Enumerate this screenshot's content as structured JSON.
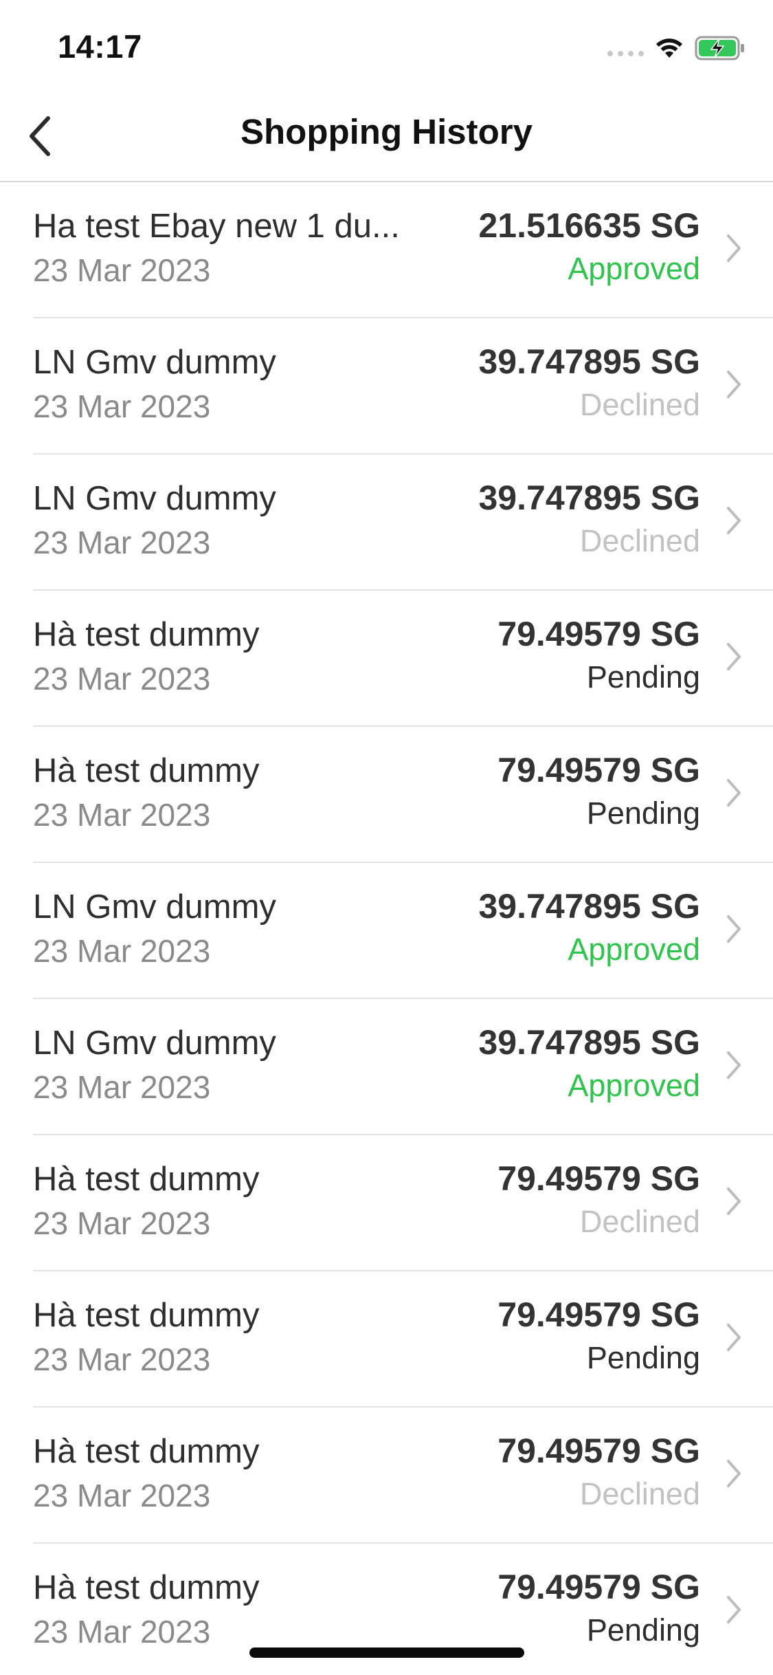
{
  "status_bar": {
    "time": "14:17",
    "icons": [
      "signal-dots-icon",
      "wifi-icon",
      "battery-charging-icon"
    ],
    "battery_color": "#34c759"
  },
  "nav": {
    "title": "Shopping History",
    "back_icon": "chevron-left-icon"
  },
  "colors": {
    "approved": "#2fc44c",
    "declined": "#c2c2c2",
    "pending": "#2e2e2e"
  },
  "transactions": [
    {
      "name": "Ha test Ebay new 1 du...",
      "date": "23 Mar 2023",
      "amount": "21.516635 SG",
      "status": "Approved"
    },
    {
      "name": "LN Gmv dummy",
      "date": "23 Mar 2023",
      "amount": "39.747895 SG",
      "status": "Declined"
    },
    {
      "name": "LN Gmv dummy",
      "date": "23 Mar 2023",
      "amount": "39.747895 SG",
      "status": "Declined"
    },
    {
      "name": "Hà test dummy",
      "date": "23 Mar 2023",
      "amount": "79.49579 SG",
      "status": "Pending"
    },
    {
      "name": "Hà test dummy",
      "date": "23 Mar 2023",
      "amount": "79.49579 SG",
      "status": "Pending"
    },
    {
      "name": "LN Gmv dummy",
      "date": "23 Mar 2023",
      "amount": "39.747895 SG",
      "status": "Approved"
    },
    {
      "name": "LN Gmv dummy",
      "date": "23 Mar 2023",
      "amount": "39.747895 SG",
      "status": "Approved"
    },
    {
      "name": "Hà test dummy",
      "date": "23 Mar 2023",
      "amount": "79.49579 SG",
      "status": "Declined"
    },
    {
      "name": "Hà test dummy",
      "date": "23 Mar 2023",
      "amount": "79.49579 SG",
      "status": "Pending"
    },
    {
      "name": "Hà test dummy",
      "date": "23 Mar 2023",
      "amount": "79.49579 SG",
      "status": "Declined"
    },
    {
      "name": "Hà test dummy",
      "date": "23 Mar 2023",
      "amount": "79.49579 SG",
      "status": "Pending"
    }
  ]
}
